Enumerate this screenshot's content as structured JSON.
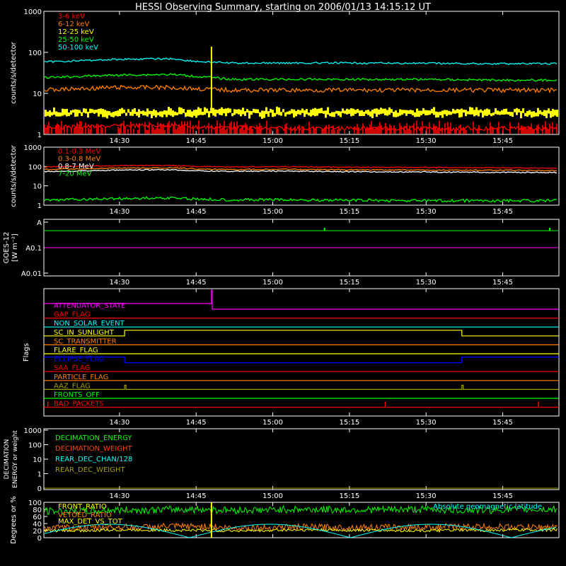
{
  "title": "HESSI Observing Summary, starting on 2006/01/13 14:15:12 UT",
  "time_ticks": [
    "14:30",
    "14:45",
    "15:00",
    "15:15",
    "15:30",
    "15:45"
  ],
  "colors": {
    "red": "#ff0000",
    "orange": "#ff8000",
    "yellow": "#ffff00",
    "green": "#00ff00",
    "cyan": "#00ffff",
    "magenta": "#ff00ff",
    "blue": "#0000ff",
    "olive": "#a0a000",
    "white": "#ffffff"
  },
  "chart_data": [
    {
      "type": "line",
      "name": "lo-energy",
      "ylabel": "counts/s/detector",
      "yscale": "log",
      "ylim": [
        1,
        1000
      ],
      "yticks": [
        "1",
        "10",
        "100",
        "1000"
      ],
      "x_range": [
        "14:15:12",
        "15:56:00"
      ],
      "legend": [
        {
          "label": "3-6 keV",
          "color": "#ff0000"
        },
        {
          "label": "6-12 keV",
          "color": "#ff8000"
        },
        {
          "label": "12-25 keV",
          "color": "#ffff00"
        },
        {
          "label": "25-50 keV",
          "color": "#00ff00"
        },
        {
          "label": "50-100 keV",
          "color": "#00ffff"
        }
      ],
      "series": [
        {
          "name": "50-100 keV",
          "color": "#00ffff",
          "x": [
            "14:15",
            "14:30",
            "14:40",
            "14:45",
            "14:52",
            "15:00",
            "15:15",
            "15:30",
            "15:45",
            "15:56"
          ],
          "values": [
            58,
            68,
            70,
            60,
            55,
            55,
            55,
            54,
            53,
            53
          ]
        },
        {
          "name": "25-50 keV",
          "color": "#00ff00",
          "x": [
            "14:15",
            "14:30",
            "14:40",
            "14:45",
            "14:52",
            "15:00",
            "15:15",
            "15:30",
            "15:45",
            "15:56"
          ],
          "values": [
            24,
            28,
            29,
            26,
            22,
            22,
            22,
            22,
            21,
            21
          ]
        },
        {
          "name": "6-12 keV",
          "color": "#ff8000",
          "x": [
            "14:15",
            "14:30",
            "14:40",
            "14:45",
            "14:52",
            "15:00",
            "15:15",
            "15:30",
            "15:45",
            "15:56"
          ],
          "values": [
            12,
            14,
            14,
            13,
            12,
            12,
            12,
            12,
            12,
            12
          ]
        },
        {
          "name": "12-25 keV",
          "color": "#ffff00",
          "x": [
            "14:15",
            "14:30",
            "14:40",
            "14:45",
            "14:52",
            "15:00",
            "15:15",
            "15:30",
            "15:45",
            "15:56"
          ],
          "values": [
            3.5,
            4,
            4.5,
            4,
            3.5,
            3.3,
            3.3,
            3.3,
            3.3,
            3.3
          ]
        },
        {
          "name": "3-6 keV",
          "color": "#ff0000",
          "x": [
            "14:15",
            "14:30",
            "14:40",
            "14:45",
            "14:52",
            "15:00",
            "15:15",
            "15:30",
            "15:45",
            "15:56"
          ],
          "values": [
            1.5,
            1.6,
            1.7,
            1.5,
            1.5,
            1.4,
            1.4,
            1.4,
            1.4,
            1.4
          ]
        }
      ]
    },
    {
      "type": "line",
      "name": "hi-energy",
      "ylabel": "counts/s/detector",
      "yscale": "log",
      "ylim": [
        1,
        1000
      ],
      "yticks": [
        "1",
        "10",
        "100",
        "1000"
      ],
      "legend": [
        {
          "label": "0.1-0.3 MeV",
          "color": "#ff0000"
        },
        {
          "label": "0.3-0.8 MeV",
          "color": "#ff8000"
        },
        {
          "label": "0.8-7 MeV",
          "color": "#ffffff"
        },
        {
          "label": "7-20 MeV",
          "color": "#00ff00"
        }
      ],
      "series": [
        {
          "name": "0.1-0.3 MeV",
          "color": "#ff0000",
          "x": [
            "14:15",
            "14:30",
            "14:40",
            "14:45",
            "14:52",
            "15:00",
            "15:15",
            "15:30",
            "15:45",
            "15:56"
          ],
          "values": [
            95,
            110,
            112,
            100,
            95,
            98,
            92,
            90,
            85,
            82
          ]
        },
        {
          "name": "0.3-0.8 MeV",
          "color": "#ff8000",
          "x": [
            "14:15",
            "14:30",
            "14:40",
            "14:45",
            "14:52",
            "15:00",
            "15:15",
            "15:30",
            "15:45",
            "15:56"
          ],
          "values": [
            70,
            82,
            85,
            75,
            70,
            72,
            68,
            66,
            64,
            62
          ]
        },
        {
          "name": "0.8-7 MeV",
          "color": "#ffffff",
          "x": [
            "14:15",
            "14:30",
            "14:40",
            "14:45",
            "14:52",
            "15:00",
            "15:15",
            "15:30",
            "15:45",
            "15:56"
          ],
          "values": [
            55,
            65,
            68,
            60,
            56,
            58,
            54,
            52,
            50,
            49
          ]
        },
        {
          "name": "7-20 MeV",
          "color": "#00ff00",
          "x": [
            "14:15",
            "14:30",
            "14:40",
            "14:45",
            "14:52",
            "15:00",
            "15:15",
            "15:30",
            "15:45",
            "15:56"
          ],
          "values": [
            1.8,
            2.2,
            2.4,
            2.1,
            1.9,
            1.9,
            1.8,
            1.7,
            1.7,
            1.7
          ]
        }
      ]
    },
    {
      "type": "line",
      "name": "goes",
      "ylabel": "GOES-12",
      "yunit": "[W m⁻²]",
      "yscale": "log",
      "yticks": [
        "A0.01",
        "A0.1",
        "A"
      ],
      "series": [
        {
          "color": "#00ff00",
          "values": [
            1.0
          ]
        },
        {
          "color": "#ff00ff",
          "values": [
            0.1
          ]
        }
      ]
    },
    {
      "type": "table",
      "name": "flags",
      "ylabel": "Flags",
      "flags": [
        {
          "label": "ATTENUATOR_STATE",
          "color": "#ff00ff"
        },
        {
          "label": "GAP_FLAG",
          "color": "#ff0000"
        },
        {
          "label": "NON_SOLAR_EVENT",
          "color": "#00ffff"
        },
        {
          "label": "SC_IN_SUNLIGHT",
          "color": "#ffff00"
        },
        {
          "label": "SC_TRANSMITTER",
          "color": "#ff8000"
        },
        {
          "label": "FLARE_FLAG",
          "color": "#ffff00"
        },
        {
          "label": "ECLIPSE_FLAG",
          "color": "#0000ff"
        },
        {
          "label": "SAA_FLAG",
          "color": "#ff0000"
        },
        {
          "label": "PARTICLE_FLAG",
          "color": "#ff8000"
        },
        {
          "label": "AAZ_FLAG",
          "color": "#a0a000"
        },
        {
          "label": "FRONTS_OFF",
          "color": "#00ff00"
        },
        {
          "label": "BAD_PACKETS",
          "color": "#ff0000"
        }
      ]
    },
    {
      "type": "line",
      "name": "decimation",
      "ylabel": "DECIMATION ENERGY or weight",
      "yticks": [
        "0",
        "1",
        "10",
        "100",
        "1000"
      ],
      "legend": [
        {
          "label": "DECIMATION_ENERGY",
          "color": "#00ff00"
        },
        {
          "label": "DECIMATION_WEIGHT",
          "color": "#ff4000"
        },
        {
          "label": "REAR_DEC_CHAN/128",
          "color": "#00ffff"
        },
        {
          "label": "REAR_DEC_WEIGHT",
          "color": "#a0a000"
        }
      ]
    },
    {
      "type": "line",
      "name": "ratios",
      "ylabel": "Degrees or %",
      "ylim": [
        0,
        100
      ],
      "yticks": [
        "0",
        "20",
        "40",
        "60",
        "80",
        "100"
      ],
      "legend": [
        {
          "label": "FRONT_RATIO",
          "color": "#ffff00"
        },
        {
          "label": "VETOED_RATIO",
          "color": "#ff8000"
        },
        {
          "label": "MAX_DET_VS_TOT",
          "color": "#ffff00"
        },
        {
          "label": "Absolute geomagnetic latitude",
          "color": "#00ffff"
        }
      ],
      "series": [
        {
          "name": "FRONT_RATIO",
          "color": "#00ff00",
          "values": [
            75,
            78,
            80,
            78,
            80,
            79,
            80,
            78,
            80
          ]
        },
        {
          "name": "VETOED_RATIO",
          "color": "#ff8000",
          "values": [
            28,
            30,
            32,
            28,
            30,
            29,
            30,
            31,
            30
          ]
        },
        {
          "name": "MAX_DET_VS_TOT",
          "color": "#ffff00",
          "values": [
            20,
            22,
            21,
            20,
            22,
            21,
            20,
            21,
            22
          ]
        }
      ]
    }
  ]
}
